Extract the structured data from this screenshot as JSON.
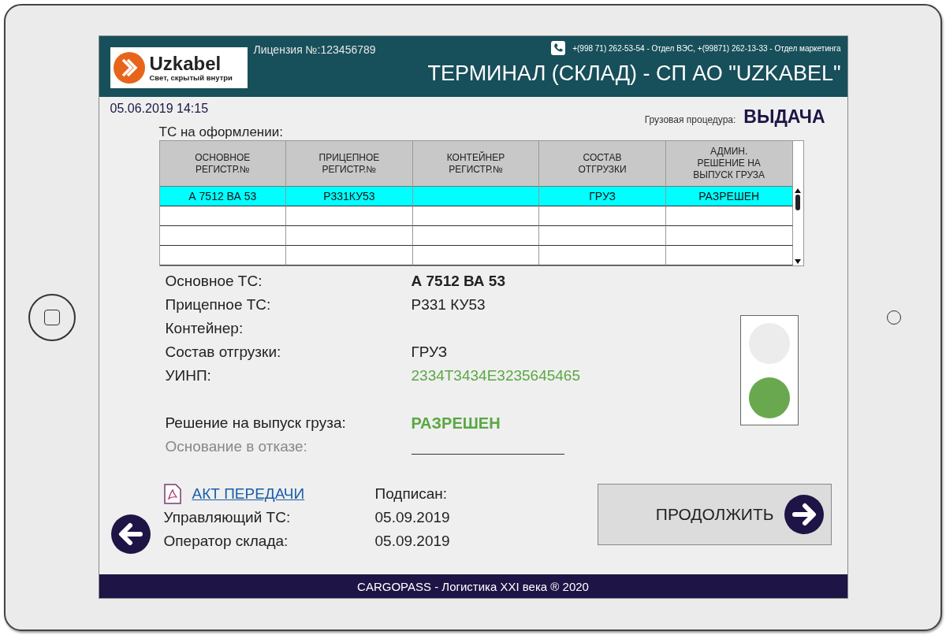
{
  "header": {
    "logo_name": "Uzkabel",
    "logo_slogan": "Свет, скрытый внутри",
    "license": "Лицензия №:123456789",
    "contacts": "+(998 71) 262-53-54 - Отдел ВЭС, +(99871) 262-13-33 - Отдел маркетинга",
    "title": "ТЕРМИНАЛ (СКЛАД) - СП АО \"UZKABEL\""
  },
  "datetime": "05.06.2019 14:15",
  "procedure": {
    "label": "Грузовая процедура:",
    "value": "ВЫДАЧА"
  },
  "table": {
    "title": "ТС на оформлении:",
    "columns": [
      "ОСНОВНОЕ РЕГИСТР.№",
      "ПРИЦЕПНОЕ РЕГИСТР.№",
      "КОНТЕЙНЕР РЕГИСТР.№",
      "СОСТАВ ОТГРУЗКИ",
      "АДМИН. РЕШЕНИЕ НА ВЫПУСК ГРУЗА"
    ],
    "rows": [
      {
        "selected": true,
        "cells": [
          "А 7512 ВА 53",
          "Р331КУ53",
          null,
          "ГРУЗ",
          "РАЗРЕШЕН"
        ]
      }
    ]
  },
  "details": [
    {
      "kind": "bold",
      "label": "Основное ТС:",
      "value": "А 7512 ВА 53",
      "disabled": false
    },
    {
      "kind": "plain",
      "label": "Прицепное ТС:",
      "value": "Р331 КУ53",
      "disabled": false
    },
    {
      "kind": "plain",
      "label": "Контейнер:",
      "disabled": false
    },
    {
      "kind": "plain",
      "label": "Состав отгрузки:",
      "value": "ГРУЗ",
      "disabled": false
    },
    {
      "kind": "code",
      "label": "УИНП:",
      "value": "2334Т3434Е3235645465",
      "disabled": false
    },
    {
      "kind": "gap"
    },
    {
      "kind": "status",
      "label": "Решение на выпуск груза:",
      "value": "РАЗРЕШЕН",
      "disabled": false
    },
    {
      "kind": "blank",
      "label": "Основание в отказе:",
      "disabled": true
    }
  ],
  "lights": [
    {
      "on": false
    },
    {
      "on": true
    }
  ],
  "act": {
    "link": "АКТ ПЕРЕДАЧИ",
    "signed_label": "Подписан:",
    "signatures": [
      {
        "role": "Управляющий ТС:",
        "date": "05.09.2019"
      },
      {
        "role": "Оператор склада:",
        "date": "05.09.2019"
      }
    ]
  },
  "continue_button": "ПРОДОЛЖИТЬ",
  "footer": "CARGOPASS - Логистика XXI века ® 2020"
}
